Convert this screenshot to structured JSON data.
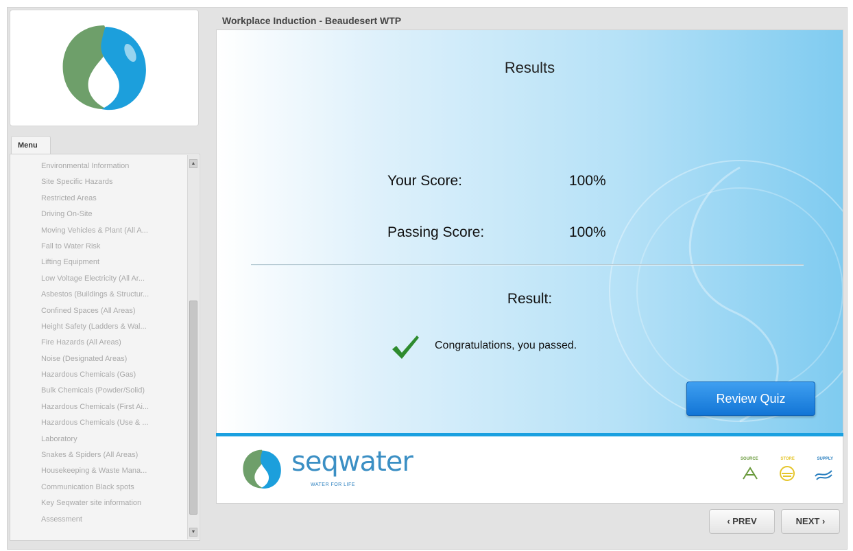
{
  "course": {
    "title": "Workplace Induction - Beaudesert WTP"
  },
  "menu": {
    "tab_label": "Menu",
    "items": [
      "Environmental Information",
      "Site Specific Hazards",
      "Restricted Areas",
      "Driving On-Site",
      "Moving Vehicles & Plant (All A...",
      "Fall to Water Risk",
      "Lifting Equipment",
      "Low Voltage Electricity (All Ar...",
      "Asbestos (Buildings & Structur...",
      "Confined Spaces (All Areas)",
      "Height Safety (Ladders & Wal...",
      "Fire Hazards (All Areas)",
      "Noise (Designated Areas)",
      "Hazardous Chemicals (Gas)",
      "Bulk Chemicals (Powder/Solid)",
      "Hazardous Chemicals (First Ai...",
      "Hazardous Chemicals (Use & ...",
      "Laboratory",
      "Snakes & Spiders (All Areas)",
      "Housekeeping & Waste Mana...",
      "Communication Black spots",
      "Key Seqwater site information",
      "Assessment"
    ]
  },
  "results": {
    "heading": "Results",
    "your_score_label": "Your Score:",
    "your_score_value": "100%",
    "passing_score_label": "Passing Score:",
    "passing_score_value": "100%",
    "result_label": "Result:",
    "result_message": "Congratulations, you passed.",
    "review_button": "Review Quiz"
  },
  "footer": {
    "brand_name": "seqwater",
    "brand_tagline": "WATER FOR LIFE",
    "source_label": "SOURCE",
    "store_label": "STORE",
    "supply_label": "SUPPLY"
  },
  "nav": {
    "prev_label": "PREV",
    "next_label": "NEXT"
  },
  "colors": {
    "brand_blue": "#3b8fc4",
    "brand_green": "#6a9a3c",
    "button_blue": "#1a7fdc",
    "check_green": "#2e8b2e"
  }
}
